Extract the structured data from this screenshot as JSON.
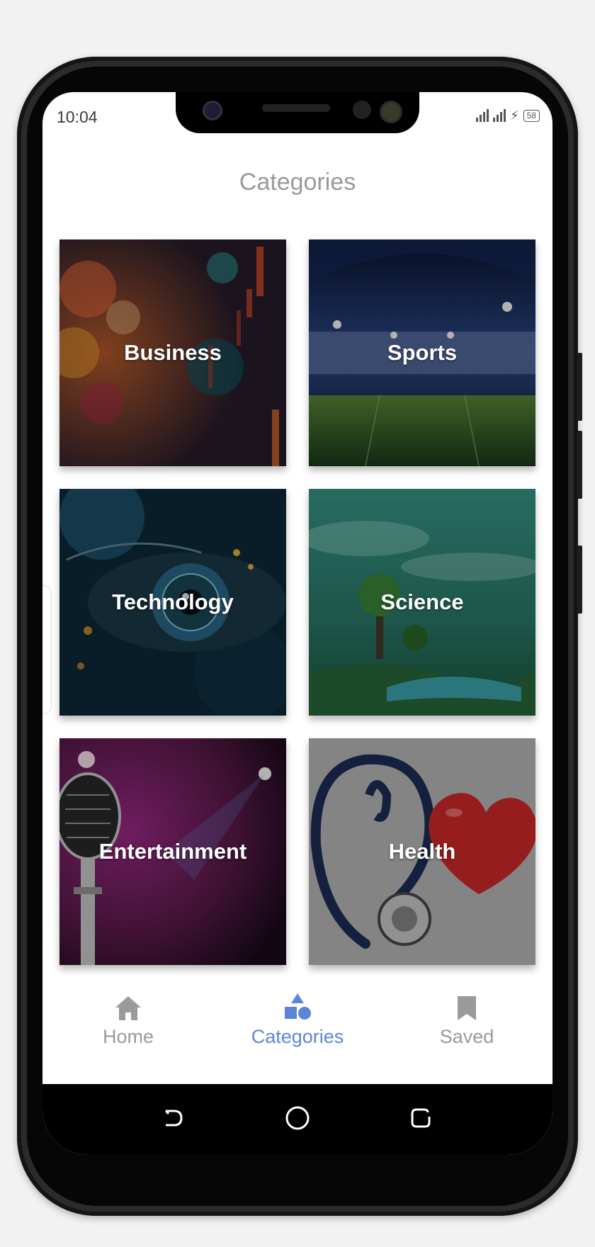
{
  "status_bar": {
    "time": "10:04",
    "battery": "58"
  },
  "page_title": "Categories",
  "categories": [
    {
      "label": "Business"
    },
    {
      "label": "Sports"
    },
    {
      "label": "Technology"
    },
    {
      "label": "Science"
    },
    {
      "label": "Entertainment"
    },
    {
      "label": "Health"
    }
  ],
  "bottom_nav": {
    "items": [
      {
        "label": "Home",
        "icon": "home-icon"
      },
      {
        "label": "Categories",
        "icon": "categories-icon"
      },
      {
        "label": "Saved",
        "icon": "bookmark-icon"
      }
    ],
    "active_index": 1
  },
  "colors": {
    "active": "#5b86d8",
    "inactive": "#9a9a9a"
  }
}
